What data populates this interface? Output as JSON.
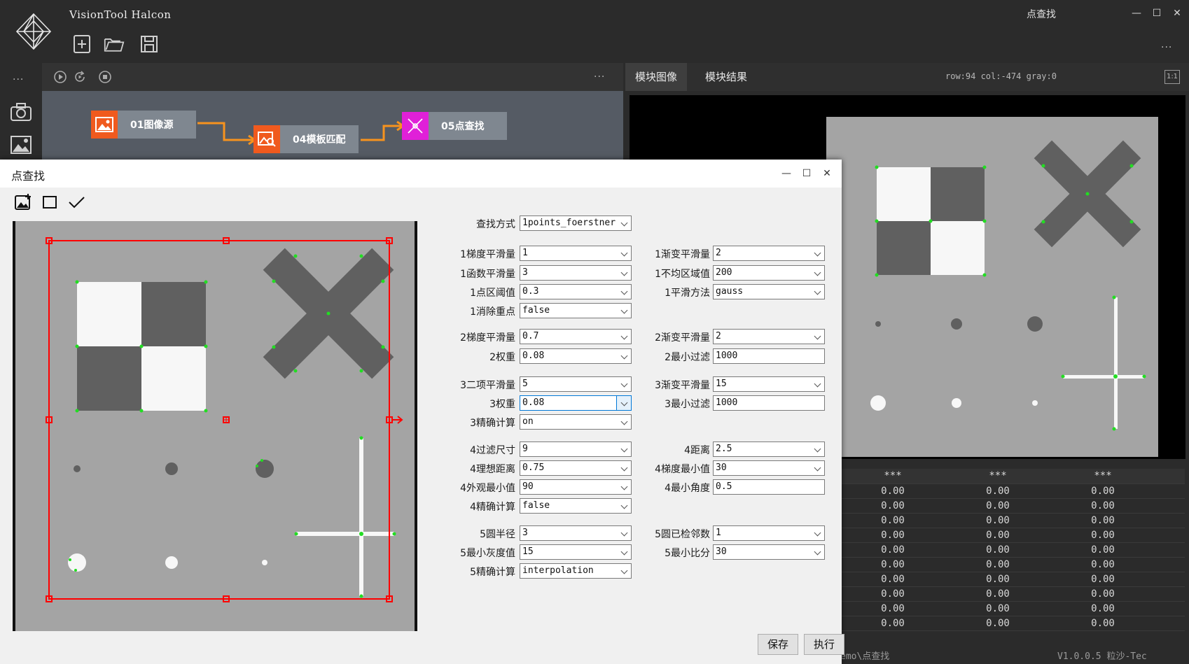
{
  "app": {
    "title": "VisionTool Halcon",
    "window_title": "点查找",
    "more_label": "...",
    "rail_more": "..."
  },
  "flow": {
    "more_label": "...",
    "nodes": [
      {
        "label": "01图像源",
        "color": "#f05a1e"
      },
      {
        "label": "04模板匹配",
        "color": "#f05a1e"
      },
      {
        "label": "05点查找",
        "color": "#e020d8"
      }
    ],
    "link_color": "#f7931e"
  },
  "right_panel": {
    "tabs": [
      "模块图像",
      "模块结果"
    ],
    "coord_readout": "row:94 col:-474 gray:0",
    "ratio_label": "1:1",
    "table": {
      "headers": [
        "***",
        "***",
        "***"
      ],
      "rows": [
        [
          "0.00",
          "0.00",
          "0.00"
        ],
        [
          "0.00",
          "0.00",
          "0.00"
        ],
        [
          "0.00",
          "0.00",
          "0.00"
        ],
        [
          "0.00",
          "0.00",
          "0.00"
        ],
        [
          "0.00",
          "0.00",
          "0.00"
        ],
        [
          "0.00",
          "0.00",
          "0.00"
        ],
        [
          "0.00",
          "0.00",
          "0.00"
        ],
        [
          "0.00",
          "0.00",
          "0.00"
        ],
        [
          "0.00",
          "0.00",
          "0.00"
        ],
        [
          "0.00",
          "0.00",
          "0.00"
        ]
      ]
    },
    "status_path": "emo\\点查找",
    "status_version": "V1.0.0.5 粒沙-Tec"
  },
  "dialog": {
    "title": "点查找",
    "save_label": "保存",
    "run_label": "执行",
    "roi_color": "#ff0000",
    "point_color": "#22dd22",
    "params": {
      "method": {
        "label": "查找方式",
        "value": "1points_foerstner"
      },
      "left": [
        {
          "label": "1梯度平滑量",
          "value": "1",
          "combo": true
        },
        {
          "label": "1函数平滑量",
          "value": "3",
          "combo": true
        },
        {
          "label": "1点区阈值",
          "value": "0.3",
          "combo": true
        },
        {
          "label": "1消除重点",
          "value": "false",
          "combo": true
        },
        {
          "label": "2梯度平滑量",
          "value": "0.7",
          "combo": true
        },
        {
          "label": "2权重",
          "value": "0.08",
          "combo": true
        },
        {
          "label": "3二项平滑量",
          "value": "5",
          "combo": true
        },
        {
          "label": "3权重",
          "value": "0.08",
          "combo": true
        },
        {
          "label": "3精确计算",
          "value": "on",
          "combo": true
        },
        {
          "label": "4过滤尺寸",
          "value": "9",
          "combo": true
        },
        {
          "label": "4理想距离",
          "value": "0.75",
          "combo": true
        },
        {
          "label": "4外观最小值",
          "value": "90",
          "combo": true
        },
        {
          "label": "4精确计算",
          "value": "false",
          "combo": true
        },
        {
          "label": "5圆半径",
          "value": "3",
          "combo": true
        },
        {
          "label": "5最小灰度值",
          "value": "15",
          "combo": true
        },
        {
          "label": "5精确计算",
          "value": "interpolation",
          "combo": true
        }
      ],
      "right": [
        {
          "label": "1渐变平滑量",
          "value": "2",
          "combo": true
        },
        {
          "label": "1不均区域值",
          "value": "200",
          "combo": true
        },
        {
          "label": "1平滑方法",
          "value": "gauss",
          "combo": true
        },
        {
          "label": "2渐变平滑量",
          "value": "2",
          "combo": true
        },
        {
          "label": "2最小过滤",
          "value": "1000",
          "combo": false
        },
        {
          "label": "3渐变平滑量",
          "value": "15",
          "combo": true
        },
        {
          "label": "3最小过滤",
          "value": "1000",
          "combo": false
        },
        {
          "label": "4距离",
          "value": "2.5",
          "combo": true
        },
        {
          "label": "4梯度最小值",
          "value": "30",
          "combo": true
        },
        {
          "label": "4最小角度",
          "value": "0.5",
          "combo": false
        },
        {
          "label": "5圆已检邻数",
          "value": "1",
          "combo": true
        },
        {
          "label": "5最小比分",
          "value": "30",
          "combo": true
        }
      ]
    }
  }
}
